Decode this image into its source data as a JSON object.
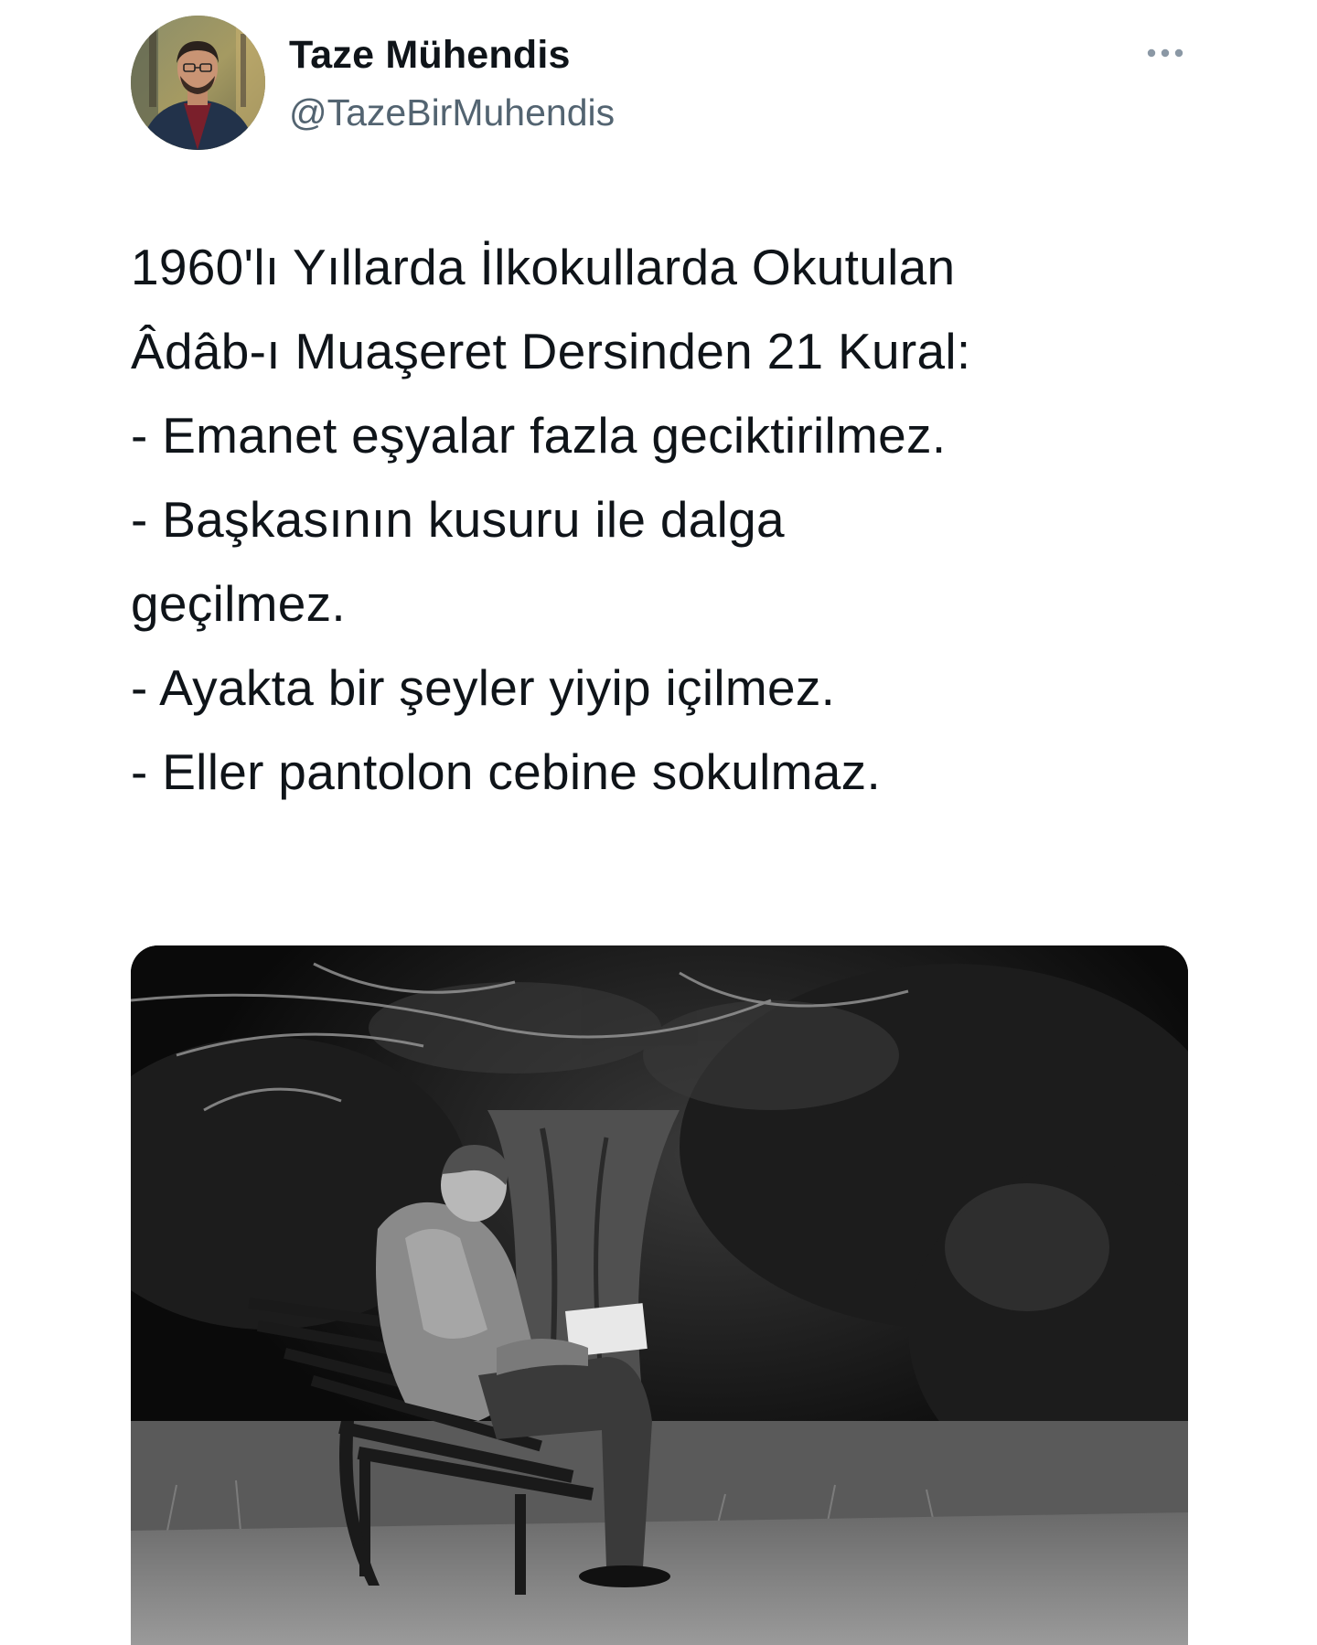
{
  "author": {
    "display_name": "Taze Mühendis",
    "handle": "@TazeBirMuhendis",
    "avatar_icon": "user-avatar-photo"
  },
  "more_icon": "more-horizontal-icon",
  "tweet": {
    "intro_line_1": "1960'lı Yıllarda İlkokullarda Okutulan",
    "intro_line_2": "Âdâb-ı Muaşeret Dersinden 21 Kural:",
    "rules": [
      {
        "line_1": "- Emanet eşyalar fazla geciktirilmez."
      },
      {
        "line_1": "- Başkasının kusuru ile dalga",
        "line_2": "geçilmez."
      },
      {
        "line_1": "- Ayakta bir şeyler yiyip içilmez."
      },
      {
        "line_1": "- Eller pantolon cebine sokulmaz."
      }
    ]
  },
  "media": {
    "type": "photo",
    "icon": "black-and-white-photo-old-man-reading-on-park-bench"
  },
  "colors": {
    "text": "#0f1419",
    "secondary_text": "#536471",
    "background": "#ffffff"
  }
}
